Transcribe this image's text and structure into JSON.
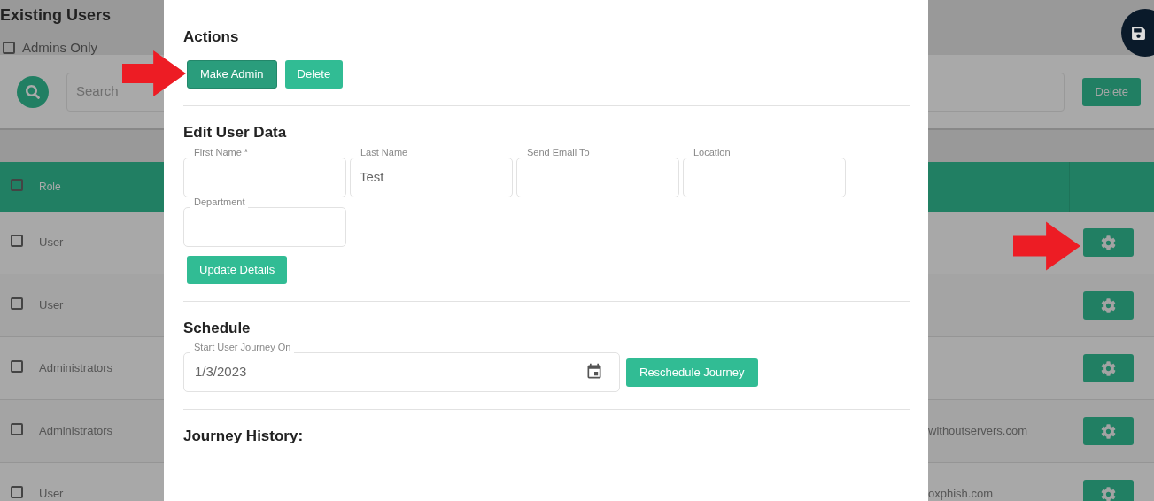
{
  "page": {
    "title": "Existing Users",
    "admins_only": {
      "label": "Admins Only",
      "checked": false
    },
    "search": {
      "placeholder": "Search"
    },
    "delete_button": "Delete",
    "table": {
      "header_checked": false,
      "columns": [
        "Role"
      ],
      "rows": [
        {
          "checked": false,
          "role": "User"
        },
        {
          "checked": false,
          "role": "User"
        },
        {
          "checked": false,
          "role": "Administrators"
        },
        {
          "checked": false,
          "role": "Administrators",
          "email": "withoutservers.com"
        },
        {
          "checked": false,
          "role": "User",
          "email": "oxphish.com"
        }
      ]
    }
  },
  "modal": {
    "actions": {
      "title": "Actions",
      "buttons": [
        {
          "label": "Make Admin",
          "focused": true
        },
        {
          "label": "Delete",
          "focused": false
        }
      ]
    },
    "edit": {
      "title": "Edit User Data",
      "fields": [
        {
          "label": "First Name *"
        },
        {
          "label": "Last Name",
          "value": "Test"
        },
        {
          "label": "Send Email To"
        },
        {
          "label": "Location"
        },
        {
          "label": "Department"
        }
      ],
      "button": "Update Details"
    },
    "schedule": {
      "title": "Schedule",
      "field": {
        "label": "Start User Journey On",
        "value": "1/3/2023"
      },
      "button": "Reschedule Journey"
    },
    "history": {
      "title": "Journey History:"
    }
  }
}
